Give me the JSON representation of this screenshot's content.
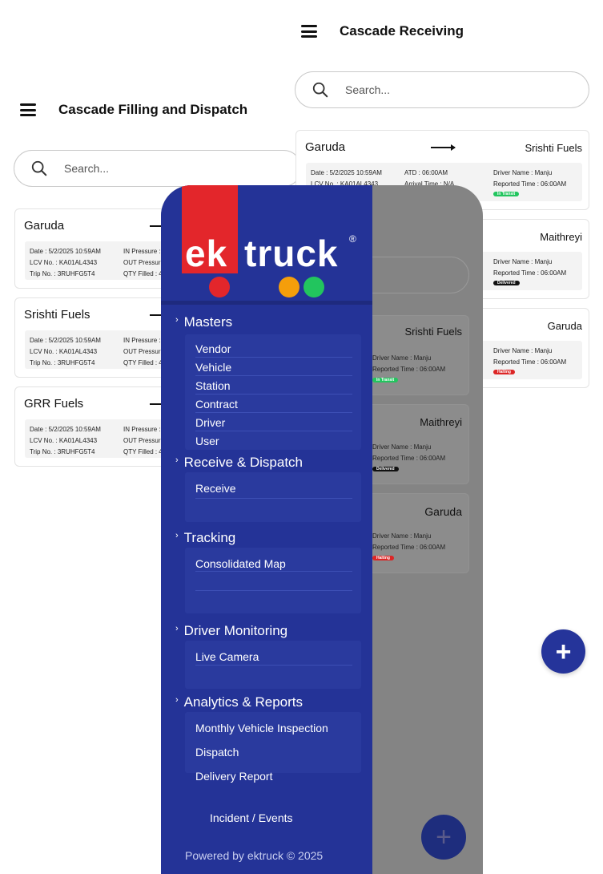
{
  "left_screen": {
    "title": "Cascade Filling and Dispatch",
    "search_placeholder": "Search...",
    "cards": [
      {
        "name": "Garuda",
        "date": "Date : 5/2/2025 10:59AM",
        "lcv": "LCV No. : KA01AL4343",
        "trip": "Trip No. : 3RUHFG5T4",
        "in_pressure": "IN Pressure :",
        "out_pressure": "OUT Pressur",
        "qty": "QTY Filled : 4"
      },
      {
        "name": "Srishti Fuels",
        "date": "Date : 5/2/2025 10:59AM",
        "lcv": "LCV No. : KA01AL4343",
        "trip": "Trip No. : 3RUHFG5T4",
        "in_pressure": "IN Pressure :",
        "out_pressure": "OUT Pressur",
        "qty": "QTY Filled : 4"
      },
      {
        "name": "GRR Fuels",
        "date": "Date : 5/2/2025 10:59AM",
        "lcv": "LCV No. : KA01AL4343",
        "trip": "Trip No. : 3RUHFG5T4",
        "in_pressure": "IN Pressure :",
        "out_pressure": "OUT Pressur",
        "qty": "QTY Filled : 4"
      }
    ]
  },
  "right_screen": {
    "title": "Cascade Receiving",
    "search_placeholder": "Search...",
    "cards": [
      {
        "name": "Garuda",
        "dest": "Srishti Fuels",
        "date": "Date : 5/2/2025 10:59AM",
        "lcv": "LCV No. : KA01AL4343",
        "atd": "ATD : 06:00AM",
        "arrival": "Arrival Time : N/A",
        "driver": "Driver Name : Manju",
        "reported": "Reported Time : 06:00AM",
        "status": "In Transit",
        "status_color": "#22c55e"
      },
      {
        "dest": "Maithreyi",
        "driver": "Driver Name : Manju",
        "reported": "Reported Time : 06:00AM",
        "status": "Delivered",
        "status_color": "#111111"
      },
      {
        "dest": "Garuda",
        "driver": "Driver Name : Manju",
        "reported": "Reported Time : 06:00AM",
        "status": "Halting",
        "status_color": "#dc2626"
      }
    ]
  },
  "middle_screen": {
    "cards": [
      {
        "dest": "Srishti Fuels",
        "driver": "Driver Name : Manju",
        "reported": "Reported Time : 06:00AM",
        "status": "In Transit",
        "status_color": "#22c55e"
      },
      {
        "dest": "Maithreyi",
        "driver": "Driver Name : Manju",
        "reported": "Reported Time : 06:00AM",
        "status": "Delivered",
        "status_color": "#111111"
      },
      {
        "dest": "Garuda",
        "driver": "Driver Name : Manju",
        "reported": "Reported Time : 06:00AM",
        "status": "Halting",
        "status_color": "#dc2626"
      }
    ]
  },
  "sidebar": {
    "logo": {
      "left": "ek",
      "right": "truck",
      "reg": "®",
      "dot_colors": [
        "#e3262b",
        "#f59e0b",
        "#22c55e"
      ]
    },
    "sections": [
      {
        "label": "Masters",
        "items": [
          "Vendor",
          "Vehicle",
          "Station",
          "Contract",
          "Driver",
          "User"
        ]
      },
      {
        "label": "Receive & Dispatch",
        "items": [
          "Receive"
        ]
      },
      {
        "label": "Tracking",
        "items": [
          "Consolidated Map"
        ]
      },
      {
        "label": "Driver Monitoring",
        "items": [
          "Live Camera"
        ]
      },
      {
        "label": "Analytics & Reports",
        "items": [
          "Monthly Vehicle Inspection",
          "Dispatch",
          "Delivery Report"
        ]
      }
    ],
    "incident_link": "Incident / Events",
    "footer": "Powered by ektruck © 2025"
  },
  "fab": {
    "label": "+"
  },
  "colors": {
    "sidebar_bg": "#243397",
    "accent_red": "#e3262b",
    "overlay": "#848484"
  }
}
